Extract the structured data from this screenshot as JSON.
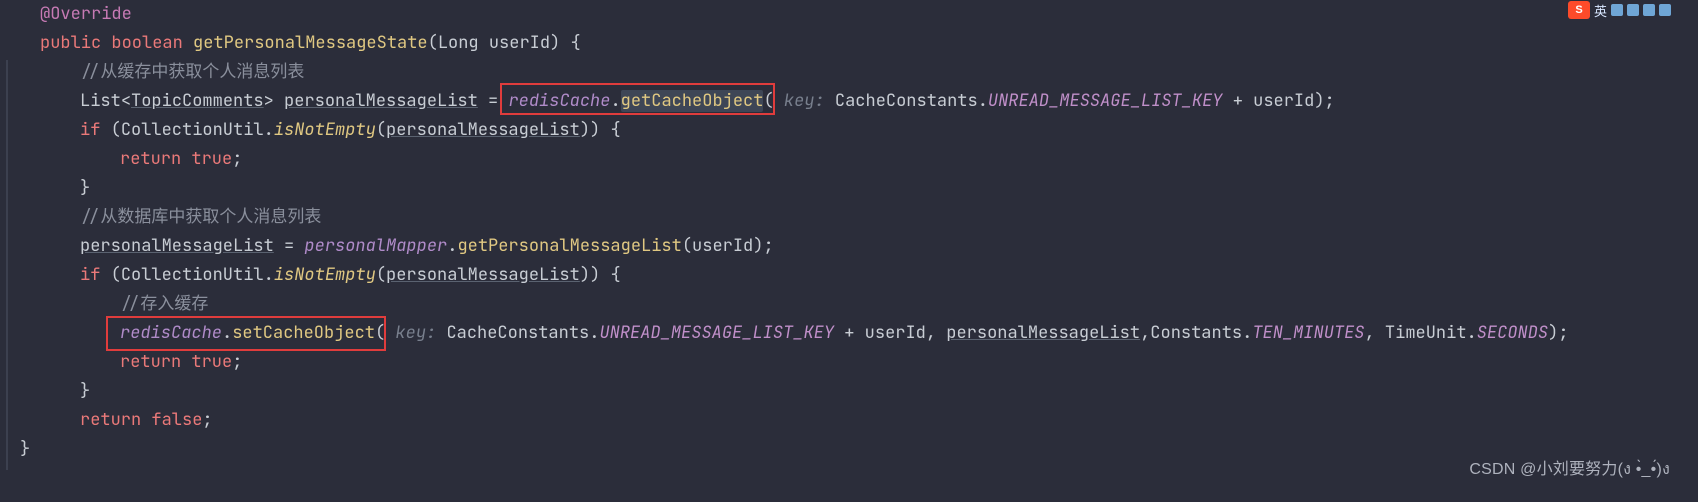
{
  "code": {
    "annotation": "@Override",
    "kwPublic": "public",
    "kwBoolean": "boolean",
    "methodName": "getPersonalMessageState",
    "paramType": "Long",
    "paramName": "userId",
    "comment1": "//从缓存中获取个人消息列表",
    "listType": "List",
    "genericType": "TopicComments",
    "varPersonalList": "personalMessageList",
    "redisCache": "redisCache",
    "getCacheObject": "getCacheObject",
    "keyHint": "key:",
    "cacheConstantsClass": "CacheConstants",
    "unreadKey": "UNREAD_MESSAGE_LIST_KEY",
    "userIdRef": "userId",
    "kwIf": "if",
    "collectionUtil": "CollectionUtil",
    "isNotEmpty": "isNotEmpty",
    "kwReturn": "return",
    "kwTrue": "true",
    "kwFalse": "false",
    "comment2": "//从数据库中获取个人消息列表",
    "personalMapper": "personalMapper",
    "getPersonalMessageList": "getPersonalMessageList",
    "comment3": "//存入缓存",
    "setCacheObject": "setCacheObject",
    "constantsClass": "Constants",
    "tenMinutes": "TEN_MINUTES",
    "timeUnit": "TimeUnit",
    "seconds": "SECONDS"
  },
  "watermark": "CSDN @小刘要努力(ง •̀_•́)ง",
  "ime": {
    "brand": "S",
    "label": "英"
  }
}
